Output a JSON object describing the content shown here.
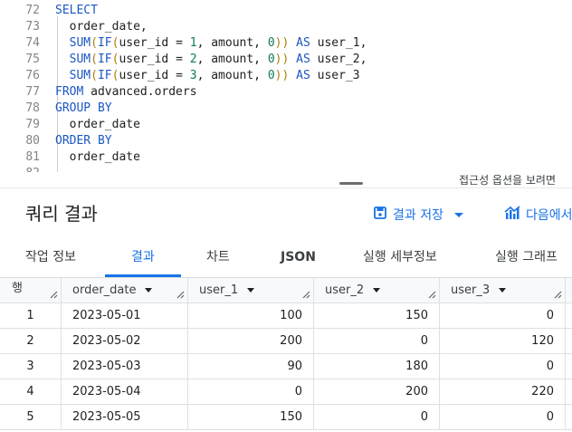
{
  "editor": {
    "lines": [
      {
        "num": "72",
        "tokens": [
          {
            "t": "SELECT",
            "c": "kw"
          }
        ]
      },
      {
        "num": "73",
        "tokens": [
          {
            "t": "  order_date,",
            "c": ""
          }
        ]
      },
      {
        "num": "74",
        "tokens": [
          {
            "t": "  ",
            "c": ""
          },
          {
            "t": "SUM",
            "c": "fn"
          },
          {
            "t": "(",
            "c": "par"
          },
          {
            "t": "IF",
            "c": "fn"
          },
          {
            "t": "(",
            "c": "par"
          },
          {
            "t": "user_id = ",
            "c": ""
          },
          {
            "t": "1",
            "c": "num"
          },
          {
            "t": ", amount, ",
            "c": ""
          },
          {
            "t": "0",
            "c": "num"
          },
          {
            "t": "))",
            "c": "par"
          },
          {
            "t": " ",
            "c": ""
          },
          {
            "t": "AS",
            "c": "kw"
          },
          {
            "t": " user_1,",
            "c": ""
          }
        ]
      },
      {
        "num": "75",
        "tokens": [
          {
            "t": "  ",
            "c": ""
          },
          {
            "t": "SUM",
            "c": "fn"
          },
          {
            "t": "(",
            "c": "par"
          },
          {
            "t": "IF",
            "c": "fn"
          },
          {
            "t": "(",
            "c": "par"
          },
          {
            "t": "user_id = ",
            "c": ""
          },
          {
            "t": "2",
            "c": "num"
          },
          {
            "t": ", amount, ",
            "c": ""
          },
          {
            "t": "0",
            "c": "num"
          },
          {
            "t": "))",
            "c": "par"
          },
          {
            "t": " ",
            "c": ""
          },
          {
            "t": "AS",
            "c": "kw"
          },
          {
            "t": " user_2,",
            "c": ""
          }
        ]
      },
      {
        "num": "76",
        "tokens": [
          {
            "t": "  ",
            "c": ""
          },
          {
            "t": "SUM",
            "c": "fn"
          },
          {
            "t": "(",
            "c": "par"
          },
          {
            "t": "IF",
            "c": "fn"
          },
          {
            "t": "(",
            "c": "par"
          },
          {
            "t": "user_id = ",
            "c": ""
          },
          {
            "t": "3",
            "c": "num"
          },
          {
            "t": ", amount, ",
            "c": ""
          },
          {
            "t": "0",
            "c": "num"
          },
          {
            "t": "))",
            "c": "par"
          },
          {
            "t": " ",
            "c": ""
          },
          {
            "t": "AS",
            "c": "kw"
          },
          {
            "t": " user_3",
            "c": ""
          }
        ]
      },
      {
        "num": "77",
        "tokens": [
          {
            "t": "FROM",
            "c": "kw"
          },
          {
            "t": " advanced.orders",
            "c": ""
          }
        ]
      },
      {
        "num": "78",
        "tokens": [
          {
            "t": "GROUP BY",
            "c": "kw"
          }
        ]
      },
      {
        "num": "79",
        "tokens": [
          {
            "t": "  order_date",
            "c": ""
          }
        ]
      },
      {
        "num": "80",
        "tokens": [
          {
            "t": "ORDER BY",
            "c": "kw"
          }
        ]
      },
      {
        "num": "81",
        "tokens": [
          {
            "t": "  order_date",
            "c": ""
          }
        ]
      },
      {
        "num": "82",
        "tokens": []
      }
    ],
    "accessibility_hint": "접근성 옵션을 보려면"
  },
  "results": {
    "title": "쿼리 결과",
    "save_label": "결과 저장",
    "explore_label": "다음에서"
  },
  "tabs": [
    {
      "label": "작업 정보",
      "active": false
    },
    {
      "label": "결과",
      "active": true
    },
    {
      "label": "차트",
      "active": false
    },
    {
      "label": "JSON",
      "active": false
    },
    {
      "label": "실행 세부정보",
      "active": false
    },
    {
      "label": "실행 그래프",
      "active": false
    }
  ],
  "table": {
    "columns": [
      "행",
      "order_date",
      "user_1",
      "user_2",
      "user_3"
    ],
    "rows": [
      [
        "1",
        "2023-05-01",
        "100",
        "150",
        "0"
      ],
      [
        "2",
        "2023-05-02",
        "200",
        "0",
        "120"
      ],
      [
        "3",
        "2023-05-03",
        "90",
        "180",
        "0"
      ],
      [
        "4",
        "2023-05-04",
        "0",
        "200",
        "220"
      ],
      [
        "5",
        "2023-05-05",
        "150",
        "0",
        "0"
      ]
    ]
  },
  "colors": {
    "accent": "#1a73e8",
    "keyword": "#1a57c4",
    "number": "#0f7b59",
    "paren": "#b27d00"
  }
}
